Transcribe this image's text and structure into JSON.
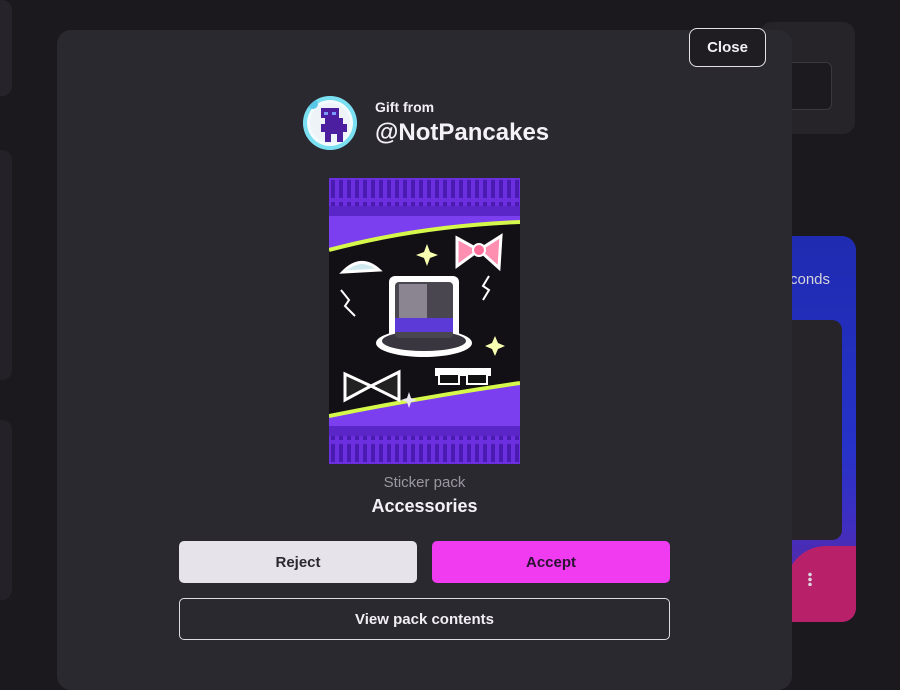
{
  "background": {
    "seconds_text": "conds"
  },
  "modal": {
    "close_label": "Close",
    "gift_from_label": "Gift from",
    "sender_username": "@NotPancakes",
    "pack_type": "Sticker pack",
    "pack_name": "Accessories",
    "reject_label": "Reject",
    "accept_label": "Accept",
    "view_contents_label": "View pack contents"
  },
  "colors": {
    "accent": "#f03bf0",
    "modal_bg": "#2b2930",
    "pack_purple": "#7b3ff0",
    "pack_lime": "#d6f84a"
  },
  "icons": [
    "avatar-character-icon",
    "top-hat-sticker",
    "bow-sticker",
    "bowtie-sticker",
    "tiara-sticker",
    "pixel-sunglasses-sticker"
  ]
}
